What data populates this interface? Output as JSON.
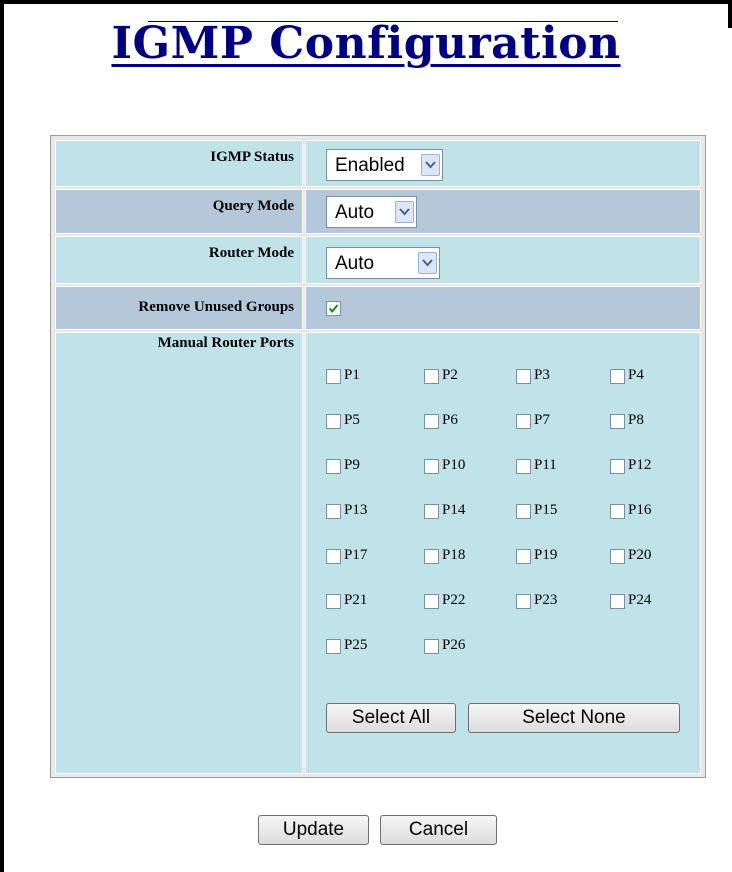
{
  "page": {
    "title": "IGMP Configuration"
  },
  "form": {
    "igmp_status": {
      "label": "IGMP Status",
      "value": "Enabled"
    },
    "query_mode": {
      "label": "Query Mode",
      "value": "Auto"
    },
    "router_mode": {
      "label": "Router Mode",
      "value": "Auto"
    },
    "remove_unused_groups": {
      "label": "Remove Unused Groups",
      "checked": true
    },
    "manual_router_ports": {
      "label": "Manual Router Ports",
      "ports": [
        "P1",
        "P2",
        "P3",
        "P4",
        "P5",
        "P6",
        "P7",
        "P8",
        "P9",
        "P10",
        "P11",
        "P12",
        "P13",
        "P14",
        "P15",
        "P16",
        "P17",
        "P18",
        "P19",
        "P20",
        "P21",
        "P22",
        "P23",
        "P24",
        "P25",
        "P26"
      ],
      "checked": [],
      "select_all_label": "Select All",
      "select_none_label": "Select None"
    }
  },
  "actions": {
    "update_label": "Update",
    "cancel_label": "Cancel"
  },
  "colors": {
    "title": "#000080",
    "row_light": "#bfe3e8",
    "row_dark": "#b4c8da",
    "check_mark": "#1a8a1a"
  }
}
